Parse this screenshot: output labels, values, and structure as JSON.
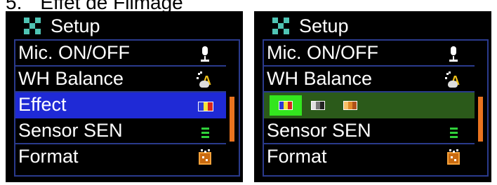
{
  "caption": {
    "number": "5.",
    "text": "Effet de Filmage"
  },
  "screens": [
    {
      "header": "Setup",
      "menu": [
        "Mic. ON/OFF",
        "WH Balance",
        "Effect",
        "Sensor SEN",
        "Format"
      ],
      "selected_index": 2
    },
    {
      "header": "Setup",
      "menu": [
        "Mic. ON/OFF",
        "WH Balance",
        "",
        "Sensor SEN",
        "Format"
      ],
      "selected_index": 2,
      "effect_options": [
        "color-effect-icon",
        "black-white-effect-icon",
        "sepia-effect-icon"
      ],
      "active_option": 0
    }
  ],
  "colors": {
    "highlight_blue": "#1f2ad6",
    "highlight_green": "#2b5a1a",
    "option_active": "#33e61e",
    "menu_border": "#2a3a8c",
    "scrollbar": "#e9731f",
    "setup_icon": "#4fc4b4"
  },
  "icons": [
    "setup-icon",
    "microphone-icon",
    "white-balance-icon",
    "effect-icon",
    "sensor-icon",
    "format-icon"
  ]
}
